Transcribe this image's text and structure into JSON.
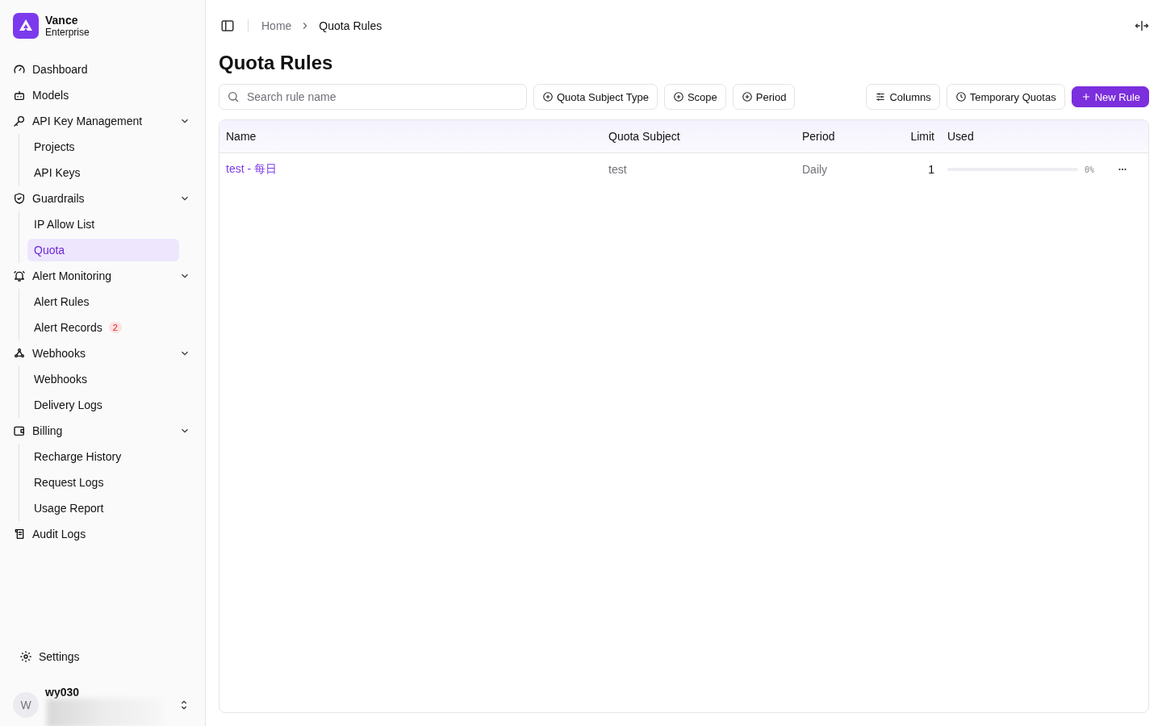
{
  "brand": {
    "name": "Vance",
    "subtitle": "Enterprise"
  },
  "nav": [
    {
      "label": "Dashboard",
      "selected": false
    },
    {
      "label": "Models",
      "selected": false
    },
    {
      "label": "API Key Management",
      "selected": false,
      "expanded": true,
      "children": [
        {
          "label": "Projects",
          "selected": false
        },
        {
          "label": "API Keys",
          "selected": false
        }
      ]
    },
    {
      "label": "Guardrails",
      "selected": false,
      "expanded": true,
      "children": [
        {
          "label": "IP Allow List",
          "selected": false
        },
        {
          "label": "Quota",
          "selected": true
        }
      ]
    },
    {
      "label": "Alert Monitoring",
      "selected": false,
      "expanded": true,
      "children": [
        {
          "label": "Alert Rules",
          "selected": false
        },
        {
          "label": "Alert Records",
          "selected": false,
          "badge": "2"
        }
      ]
    },
    {
      "label": "Webhooks",
      "selected": false,
      "expanded": true,
      "children": [
        {
          "label": "Webhooks",
          "selected": false
        },
        {
          "label": "Delivery Logs",
          "selected": false
        }
      ]
    },
    {
      "label": "Billing",
      "selected": false,
      "expanded": true,
      "children": [
        {
          "label": "Recharge History",
          "selected": false
        },
        {
          "label": "Request Logs",
          "selected": false
        },
        {
          "label": "Usage Report",
          "selected": false
        }
      ]
    },
    {
      "label": "Audit Logs",
      "selected": false
    }
  ],
  "settings": "Settings",
  "user": {
    "initial": "W",
    "name": "wy030"
  },
  "breadcrumb": [
    "Home",
    "Quota Rules"
  ],
  "title": "Quota Rules",
  "search": {
    "placeholder": "Search rule name"
  },
  "filters": [
    "Quota Subject Type",
    "Scope",
    "Period"
  ],
  "toolbar": {
    "columns": "Columns",
    "temporary": "Temporary Quotas",
    "new": "New Rule"
  },
  "table": {
    "columns": [
      "Name",
      "Quota Subject",
      "Period",
      "Limit",
      "Used"
    ],
    "rows": [
      {
        "name": "test - 每日",
        "subject": "test",
        "period": "Daily",
        "limit": "1",
        "level": 0,
        "reading": "0%"
      }
    ]
  }
}
